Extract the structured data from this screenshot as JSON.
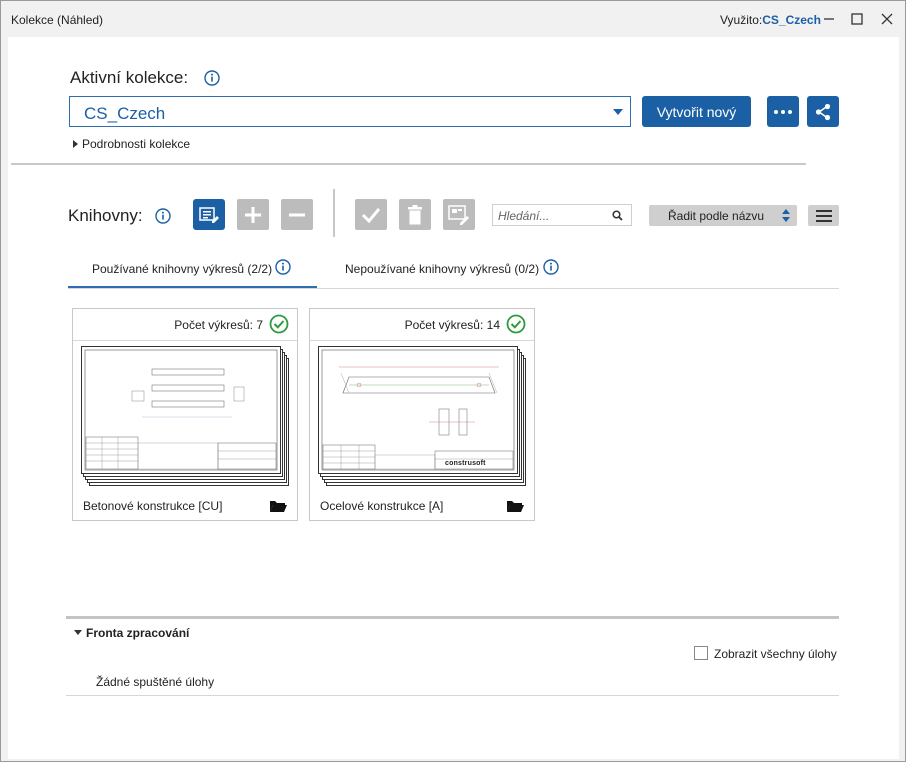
{
  "window": {
    "title": "Kolekce (Náhled)",
    "usage_label": "Využito:",
    "usage_value": "CS_Czech"
  },
  "collection": {
    "heading": "Aktivní kolekce:",
    "selected": "CS_Czech",
    "create_label": "Vytvořit nový",
    "details_label": "Podrobnosti kolekce"
  },
  "libraries": {
    "heading": "Knihovny:",
    "search_placeholder": "Hledání...",
    "sort_label": "Řadit podle názvu",
    "tabs": [
      {
        "label": "Používané knihovny výkresů (2/2)",
        "active": true
      },
      {
        "label": "Nepoužívané knihovny výkresů (0/2)",
        "active": false
      }
    ],
    "cards": [
      {
        "count_label": "Počet výkresů: 7",
        "name": "Betonové konstrukce [CU]"
      },
      {
        "count_label": "Počet výkresů: 14",
        "name": "Ocelové konstrukce [A]",
        "brand": "construsoft"
      }
    ]
  },
  "queue": {
    "heading": "Fronta zpracování",
    "show_all_label": "Zobrazit všechny úlohy",
    "empty_label": "Žádné spuštěné úlohy"
  },
  "colors": {
    "accent": "#1b60a4",
    "success": "#2e9a3e",
    "disabled": "#bcbcbc"
  }
}
